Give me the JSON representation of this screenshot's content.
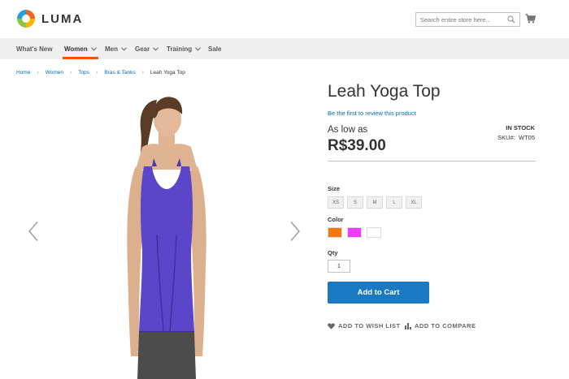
{
  "header": {
    "logo_text": "LUMA",
    "search_placeholder": "Search entire store here...",
    "icons": [
      "luma-logo-icon",
      "search-icon",
      "cart-icon"
    ]
  },
  "nav": {
    "items": [
      {
        "label": "What's New",
        "has_dropdown": false,
        "active": false
      },
      {
        "label": "Women",
        "has_dropdown": true,
        "active": true
      },
      {
        "label": "Men",
        "has_dropdown": true,
        "active": false
      },
      {
        "label": "Gear",
        "has_dropdown": true,
        "active": false
      },
      {
        "label": "Training",
        "has_dropdown": true,
        "active": false
      },
      {
        "label": "Sale",
        "has_dropdown": false,
        "active": false
      }
    ],
    "active_color": "#ff5501"
  },
  "breadcrumb": [
    "Home",
    "Women",
    "Tops",
    "Bras & Tanks",
    "Leah Yoga Top"
  ],
  "gallery": {
    "prev_icon": "chevron-left-icon",
    "next_icon": "chevron-right-icon"
  },
  "product": {
    "title": "Leah Yoga Top",
    "review_link": "Be the first to review this product",
    "price_prefix": "As low as",
    "price": "R$39.00",
    "stock": "IN STOCK",
    "sku_label": "SKU#:",
    "sku_value": "WT05",
    "size_label": "Size",
    "sizes": [
      "XS",
      "S",
      "M",
      "L",
      "XL"
    ],
    "color_label": "Color",
    "colors": [
      "#ef7a0a",
      "#ef3dff",
      "#ffffff"
    ],
    "qty_label": "Qty",
    "qty_value": "1",
    "add_to_cart": "Add to Cart",
    "wishlist": "ADD TO WISH LIST",
    "compare": "ADD TO COMPARE"
  },
  "colors": {
    "link": "#006bb4",
    "primary_button": "#1979c3"
  }
}
